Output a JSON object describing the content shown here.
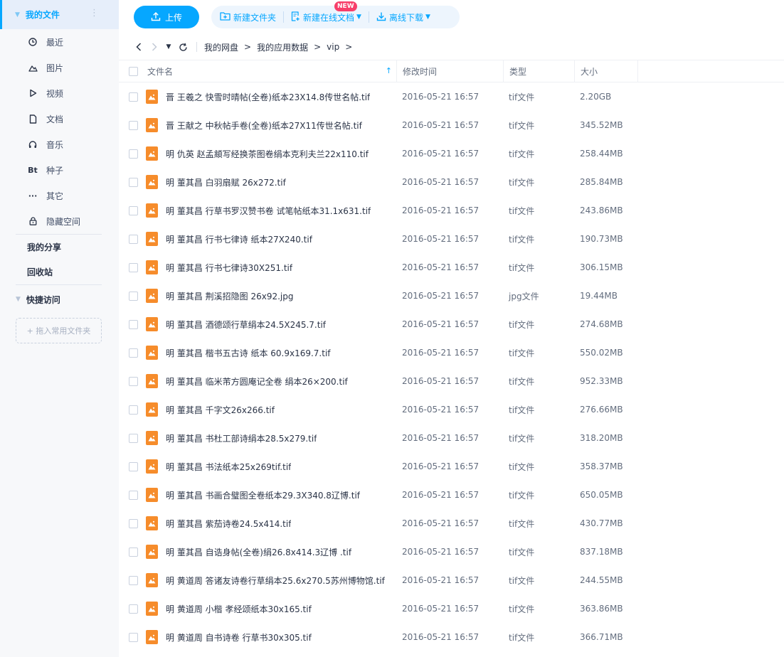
{
  "sidebar": {
    "title": "我的文件",
    "items": [
      {
        "label": "最近",
        "icon": "clock-icon"
      },
      {
        "label": "图片",
        "icon": "image-icon"
      },
      {
        "label": "视频",
        "icon": "play-icon"
      },
      {
        "label": "文档",
        "icon": "document-icon"
      },
      {
        "label": "音乐",
        "icon": "headphones-icon"
      },
      {
        "label": "种子",
        "icon": "torrent-icon",
        "glyph": "Bt"
      },
      {
        "label": "其它",
        "icon": "more-icon",
        "glyph": "···"
      },
      {
        "label": "隐藏空间",
        "icon": "lock-icon"
      }
    ],
    "share": "我的分享",
    "recycle": "回收站",
    "quick_access": "快捷访问",
    "drop_hint": "+ 拖入常用文件夹"
  },
  "toolbar": {
    "upload": "上传",
    "new_folder": "新建文件夹",
    "new_doc": "新建在线文档",
    "new_badge": "NEW",
    "offline": "离线下载"
  },
  "breadcrumb": [
    "我的网盘",
    "我的应用数据",
    "vip"
  ],
  "table": {
    "headers": {
      "name": "文件名",
      "time": "修改时间",
      "type": "类型",
      "size": "大小"
    },
    "rows": [
      {
        "name": "晋 王羲之 快雪时晴帖(全卷)纸本23X14.8传世名帖.tif",
        "time": "2016-05-21 16:57",
        "type": "tif文件",
        "size": "2.20GB"
      },
      {
        "name": "晋 王献之 中秋帖手卷(全卷)纸本27X11传世名帖.tif",
        "time": "2016-05-21 16:57",
        "type": "tif文件",
        "size": "345.52MB"
      },
      {
        "name": "明 仇英 赵孟頫写经换茶图卷绢本克利夫兰22x110.tif",
        "time": "2016-05-21 16:57",
        "type": "tif文件",
        "size": "258.44MB"
      },
      {
        "name": "明 董其昌 白羽扇赋 26x272.tif",
        "time": "2016-05-21 16:57",
        "type": "tif文件",
        "size": "285.84MB"
      },
      {
        "name": "明 董其昌 行草书罗汉赞书卷 试笔帖纸本31.1x631.tif",
        "time": "2016-05-21 16:57",
        "type": "tif文件",
        "size": "243.86MB"
      },
      {
        "name": "明 董其昌 行书七律诗 纸本27X240.tif",
        "time": "2016-05-21 16:57",
        "type": "tif文件",
        "size": "190.73MB"
      },
      {
        "name": "明 董其昌 行书七律诗30X251.tif",
        "time": "2016-05-21 16:57",
        "type": "tif文件",
        "size": "306.15MB"
      },
      {
        "name": "明 董其昌 荆溪招隐图 26x92.jpg",
        "time": "2016-05-21 16:57",
        "type": "jpg文件",
        "size": "19.44MB"
      },
      {
        "name": "明 董其昌 酒德颂行草绢本24.5X245.7.tif",
        "time": "2016-05-21 16:57",
        "type": "tif文件",
        "size": "274.68MB"
      },
      {
        "name": "明 董其昌 楷书五古诗 纸本 60.9x169.7.tif",
        "time": "2016-05-21 16:57",
        "type": "tif文件",
        "size": "550.02MB"
      },
      {
        "name": "明 董其昌 临米芾方圆庵记全卷 绢本26×200.tif",
        "time": "2016-05-21 16:57",
        "type": "tif文件",
        "size": "952.33MB"
      },
      {
        "name": "明 董其昌 千字文26x266.tif",
        "time": "2016-05-21 16:57",
        "type": "tif文件",
        "size": "276.66MB"
      },
      {
        "name": "明 董其昌 书杜工部诗绢本28.5x279.tif",
        "time": "2016-05-21 16:57",
        "type": "tif文件",
        "size": "318.20MB"
      },
      {
        "name": "明 董其昌 书法纸本25x269tif.tif",
        "time": "2016-05-21 16:57",
        "type": "tif文件",
        "size": "358.37MB"
      },
      {
        "name": "明 董其昌 书画合璧图全卷纸本29.3X340.8辽博.tif",
        "time": "2016-05-21 16:57",
        "type": "tif文件",
        "size": "650.05MB"
      },
      {
        "name": "明 董其昌 紫茄诗卷24.5x414.tif",
        "time": "2016-05-21 16:57",
        "type": "tif文件",
        "size": "430.77MB"
      },
      {
        "name": "明 董其昌 自诰身帖(全卷)绢26.8x414.3辽博 .tif",
        "time": "2016-05-21 16:57",
        "type": "tif文件",
        "size": "837.18MB"
      },
      {
        "name": "明 黄道周 答诸友诗卷行草绢本25.6x270.5苏州博物馆.tif",
        "time": "2016-05-21 16:57",
        "type": "tif文件",
        "size": "244.55MB"
      },
      {
        "name": "明 黄道周 小楷 孝经颂纸本30x165.tif",
        "time": "2016-05-21 16:57",
        "type": "tif文件",
        "size": "363.86MB"
      },
      {
        "name": "明 黄道周 自书诗卷 行草书30x305.tif",
        "time": "2016-05-21 16:57",
        "type": "tif文件",
        "size": "366.71MB"
      }
    ]
  },
  "colors": {
    "accent": "#06a7ff",
    "file_icon": "#f68c2b",
    "badge": "#f73f6a"
  }
}
